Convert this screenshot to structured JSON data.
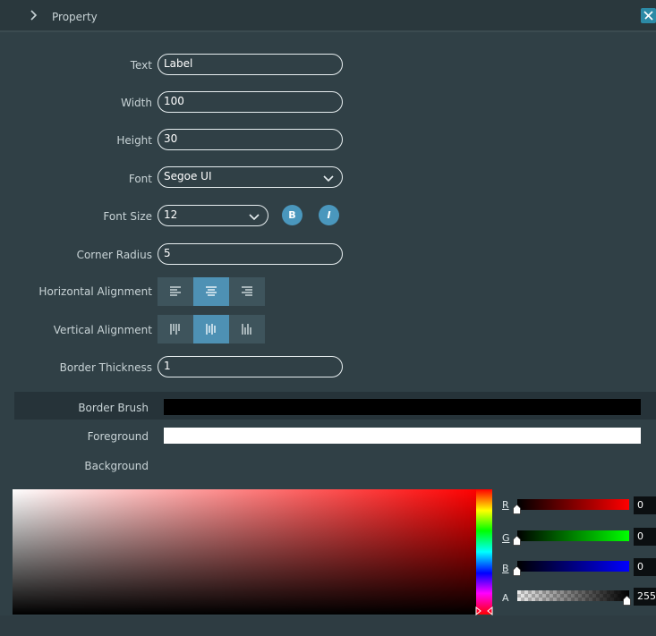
{
  "panel": {
    "title": "Property"
  },
  "fields": {
    "text": {
      "label": "Text",
      "value": "Label"
    },
    "width": {
      "label": "Width",
      "value": "100"
    },
    "height": {
      "label": "Height",
      "value": "30"
    },
    "font": {
      "label": "Font",
      "value": "Segoe UI"
    },
    "font_size": {
      "label": "Font Size",
      "value": "12",
      "bold_label": "B",
      "italic_label": "I"
    },
    "corner_radius": {
      "label": "Corner Radius",
      "value": "5"
    },
    "horizontal_alignment": {
      "label": "Horizontal Alignment",
      "selected": "center"
    },
    "vertical_alignment": {
      "label": "Vertical Alignment",
      "selected": "center"
    },
    "border_thickness": {
      "label": "Border Thickness",
      "value": "1"
    }
  },
  "brushes": {
    "border_brush": {
      "label": "Border Brush",
      "color": "#000000"
    },
    "foreground": {
      "label": "Foreground",
      "color": "#ffffff"
    },
    "background": {
      "label": "Background"
    }
  },
  "color_picker": {
    "r": {
      "label": "R",
      "value": "0"
    },
    "g": {
      "label": "G",
      "value": "0"
    },
    "b": {
      "label": "B",
      "value": "0"
    },
    "a": {
      "label": "A",
      "value": "255"
    }
  },
  "colors": {
    "accent": "#4a97bd",
    "panel_bg": "#304046",
    "active_segment": "#4e91b4"
  }
}
